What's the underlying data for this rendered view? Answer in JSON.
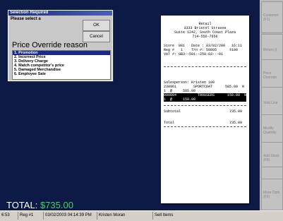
{
  "dialog": {
    "title": "Selection Required",
    "prompt": "Please select a",
    "heading": "Price Override reason",
    "ok_label": "OK",
    "cancel_label": "Cancel",
    "items": [
      {
        "label": "1.   Promotion",
        "selected": true
      },
      {
        "label": "2.   Incorrect Price",
        "selected": false
      },
      {
        "label": "3.   Delivery Charge",
        "selected": false
      },
      {
        "label": "4.   Match competitor's price",
        "selected": false
      },
      {
        "label": "5.   Damaged Merchandise",
        "selected": false
      },
      {
        "label": "6.   Employee Sale",
        "selected": false
      }
    ]
  },
  "total": {
    "label": "TOTAL:",
    "amount": "$735.00"
  },
  "statusbar": {
    "time": "6:53",
    "register": "Reg #1",
    "datetime": "03/02/2003 04:14:39 PM",
    "cashier": "Kristen Moran",
    "status": "Sell Items"
  },
  "receipt": {
    "store": "Retail",
    "address1": "3333 Bristol Strasse",
    "address2": "Suite 1242, South Coast Plaza",
    "phone": "714-556-7656",
    "line1": "Store  801   Date : 03/02/200   16:11",
    "line2": "Reg #   1    Trn #: 50805      ±100",
    "line3": "VAT #: GB3--501--258-63---01",
    "salesperson": "Salesperson: Kristen 100",
    "item1": "230961        SPORTCOAT      585.00  N",
    "item1_qty": "1  @     585.00",
    "item2": "000004          TROUSERS      150.00  N",
    "item2_qty": "1  @     150.00",
    "subtotal": "Subtotal                       735.00",
    "total": "Total                          735.00"
  },
  "sidebar": {
    "buttons": [
      "Customer (F1)",
      "Return (I",
      "Price Override",
      "Void Line",
      "Modify Quantity",
      "Add Stock (F8)",
      "Suspend",
      "More Opts (F9)"
    ]
  }
}
